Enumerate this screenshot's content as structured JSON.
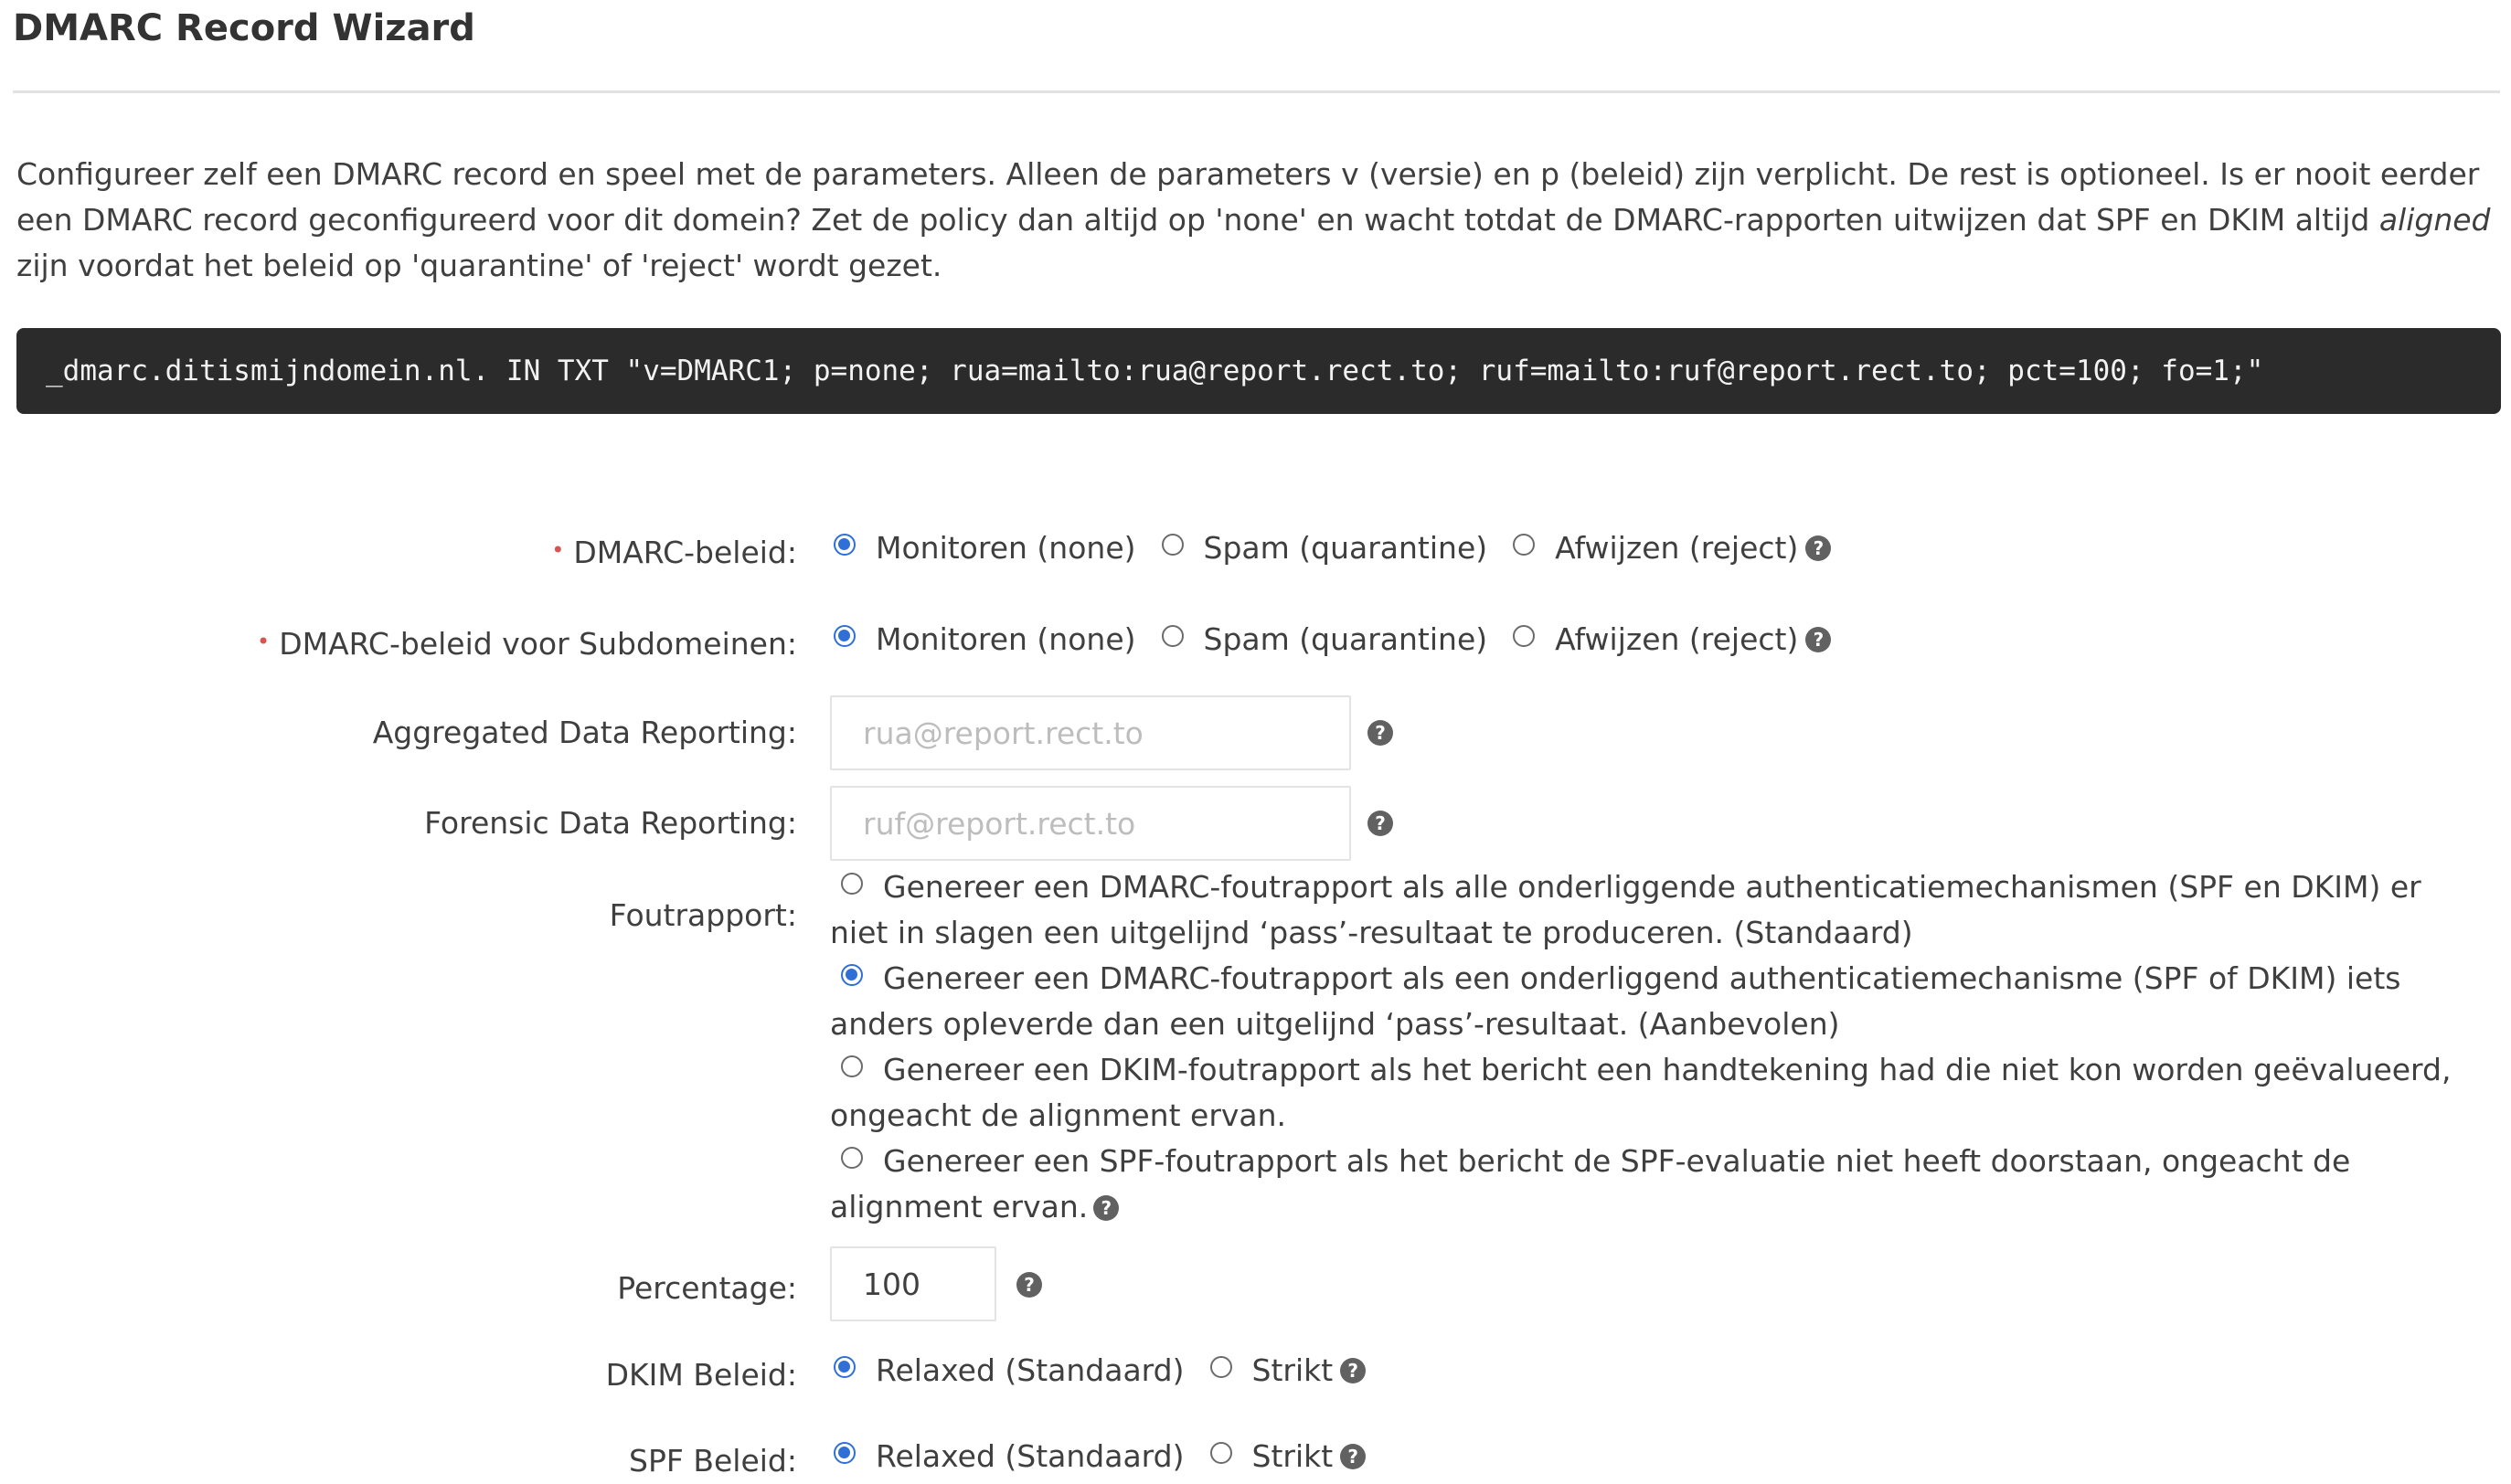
{
  "header": {
    "title": "DMARC Record Wizard"
  },
  "intro": {
    "text_before": "Configureer zelf een DMARC record en speel met de parameters. Alleen de parameters v (versie) en p (beleid) zijn verplicht. De rest is optioneel. Is er nooit eerder een DMARC record geconfigureerd voor dit domein? Zet de policy dan altijd op 'none' en wacht totdat de DMARC-rapporten uitwijzen dat SPF en DKIM altijd ",
    "text_italic": "aligned",
    "text_after": " zijn voordat het beleid op 'quarantine' of 'reject' wordt gezet."
  },
  "record": "_dmarc.ditismijndomein.nl. IN TXT \"v=DMARC1; p=none; rua=mailto:rua@report.rect.to; ruf=mailto:ruf@report.rect.to; pct=100; fo=1;\"",
  "form": {
    "required_mark": "•",
    "help_glyph": "?",
    "policy": {
      "label": "DMARC-beleid:",
      "options": [
        "Monitoren (none)",
        "Spam (quarantine)",
        "Afwijzen (reject)"
      ],
      "selected": 0
    },
    "subdomain_policy": {
      "label": "DMARC-beleid voor Subdomeinen:",
      "options": [
        "Monitoren (none)",
        "Spam (quarantine)",
        "Afwijzen (reject)"
      ],
      "selected": 0
    },
    "aggregated": {
      "label": "Aggregated Data Reporting:",
      "placeholder": "rua@report.rect.to",
      "value": ""
    },
    "forensic": {
      "label": "Forensic Data Reporting:",
      "placeholder": "ruf@report.rect.to",
      "value": ""
    },
    "foutrapport": {
      "label": "Foutrapport:",
      "options": [
        "Genereer een DMARC-foutrapport als alle onderliggende authenticatiemechanismen (SPF en DKIM) er niet in slagen een uitgelijnd ‘pass’-resultaat te produceren. (Standaard)",
        "Genereer een DMARC-foutrapport als een onderliggend authenticatiemechanisme (SPF of DKIM) iets anders opleverde dan een uitgelijnd ‘pass’-resultaat. (Aanbevolen)",
        "Genereer een DKIM-foutrapport als het bericht een handtekening had die niet kon worden geëvalueerd, ongeacht de alignment ervan.",
        "Genereer een SPF-foutrapport als het bericht de SPF-evaluatie niet heeft doorstaan, ongeacht de alignment ervan."
      ],
      "selected": 1
    },
    "percentage": {
      "label": "Percentage:",
      "value": "100"
    },
    "dkim": {
      "label": "DKIM Beleid:",
      "options": [
        "Relaxed (Standaard)",
        "Strikt"
      ],
      "selected": 0
    },
    "spf": {
      "label": "SPF Beleid:",
      "options": [
        "Relaxed (Standaard)",
        "Strikt"
      ],
      "selected": 0
    }
  },
  "colors": {
    "accent": "#2f6fd6",
    "required": "#d9534f",
    "code_bg": "#2b2b2b",
    "help_icon": "#616161"
  }
}
